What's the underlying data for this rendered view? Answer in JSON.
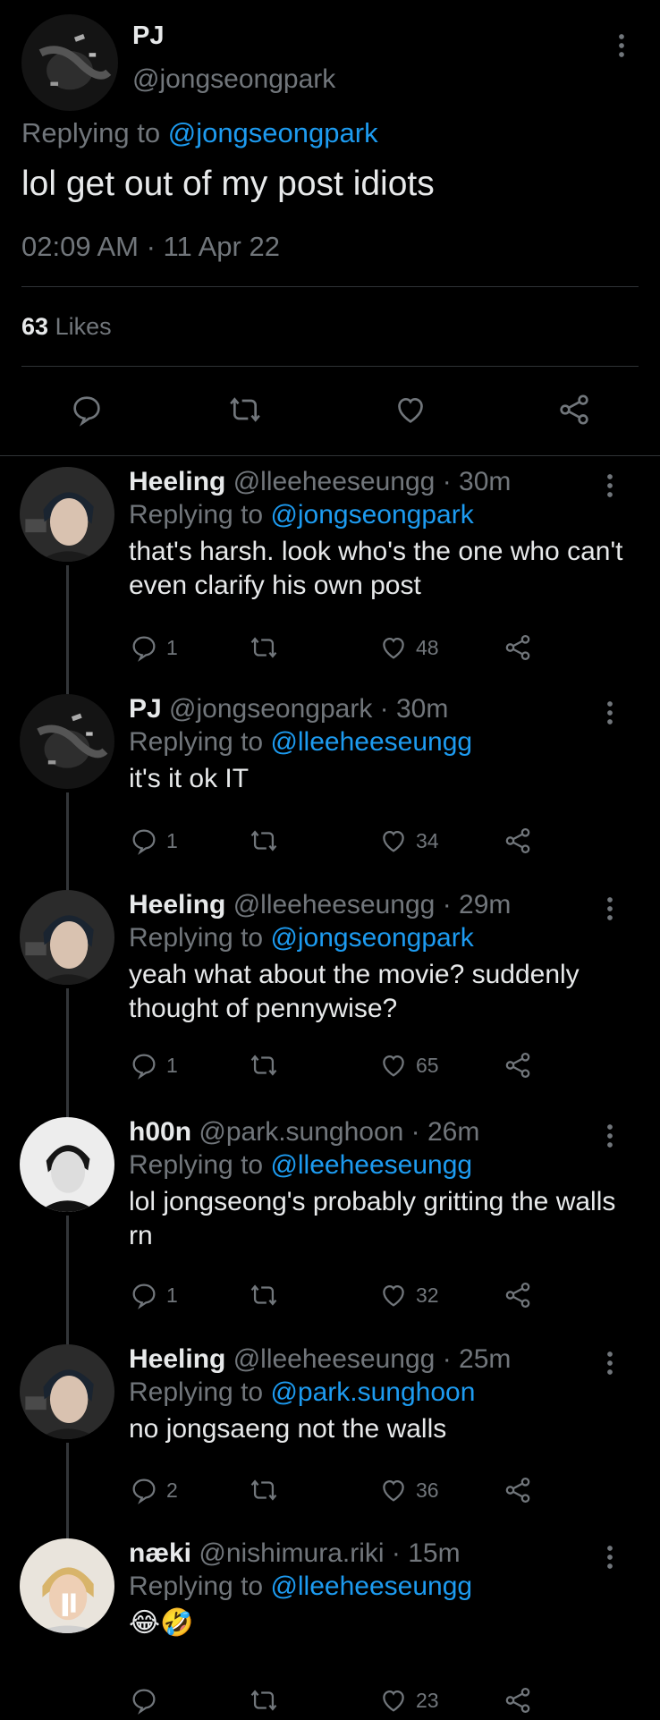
{
  "main": {
    "name": "PJ",
    "handle": "@jongseongpark",
    "replying_prefix": "Replying to",
    "replying_to": "@jongseongpark",
    "text": "lol get out of my post idiots",
    "timestamp": "02:09 AM · 11 Apr 22",
    "likes_count": "63",
    "likes_label": "Likes"
  },
  "replies": [
    {
      "name": "Heeling",
      "handle": "@lleeheeseungg",
      "time": "· 30m",
      "replying_prefix": "Replying to",
      "replying_to": "@jongseongpark",
      "text": "that's harsh. look who's the one who can't even clarify his own post",
      "reply_count": "1",
      "retweet_count": "",
      "like_count": "48"
    },
    {
      "name": "PJ",
      "handle": "@jongseongpark",
      "time": "· 30m",
      "replying_prefix": "Replying to",
      "replying_to": "@lleeheeseungg",
      "text": "it's it ok IT",
      "reply_count": "1",
      "retweet_count": "",
      "like_count": "34"
    },
    {
      "name": "Heeling",
      "handle": "@lleeheeseungg",
      "time": "· 29m",
      "replying_prefix": "Replying to",
      "replying_to": "@jongseongpark",
      "text": "yeah what about the movie? suddenly thought of pennywise?",
      "reply_count": "1",
      "retweet_count": "",
      "like_count": "65"
    },
    {
      "name": "h00n",
      "handle": "@park.sunghoon",
      "time": "· 26m",
      "replying_prefix": "Replying to",
      "replying_to": "@lleeheeseungg",
      "text": "lol jongseong's probably gritting the walls rn",
      "reply_count": "1",
      "retweet_count": "",
      "like_count": "32"
    },
    {
      "name": "Heeling",
      "handle": "@lleeheeseungg",
      "time": "· 25m",
      "replying_prefix": "Replying to",
      "replying_to": "@park.sunghoon",
      "text": "no jongsaeng not the walls",
      "reply_count": "2",
      "retweet_count": "",
      "like_count": "36"
    },
    {
      "name": "næki",
      "handle": "@nishimura.riki",
      "time": "· 15m",
      "replying_prefix": "Replying to",
      "replying_to": "@lleeheeseungg",
      "text": "😂🤣",
      "reply_count": "",
      "retweet_count": "",
      "like_count": "23"
    }
  ],
  "icons": {
    "reply": "reply-icon",
    "retweet": "retweet-icon",
    "like": "heart-icon",
    "share": "share-icon",
    "more": "more-vertical-icon"
  },
  "colors": {
    "background": "#000000",
    "link": "#1d9bf0",
    "secondary": "#71767b",
    "primary": "#e7e9ea"
  }
}
